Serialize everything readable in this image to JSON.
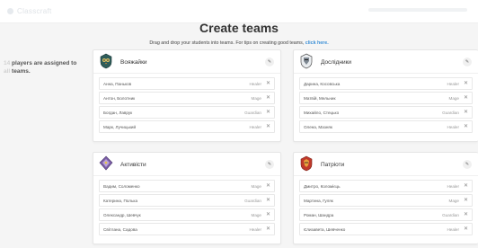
{
  "topbar": {
    "brand": "Classcraft"
  },
  "header": {
    "title": "Create teams",
    "subtitle_text": "Drag and drop your students into teams. For tips on creating good teams, ",
    "subtitle_link": "click here."
  },
  "side_note": {
    "number": "14",
    "text_1": " players are assigned to",
    "text_2": "teams."
  },
  "colors": {
    "link": "#3b8fd6",
    "accent_purple": "#7b5ea7",
    "accent_red": "#c0392b"
  },
  "teams": [
    {
      "name": "Вояжайки",
      "emblem": "owl-crest-icon",
      "players": [
        {
          "name": "Анна, Паньков",
          "role": "Healer"
        },
        {
          "name": "Антон, Болотник",
          "role": "Mage"
        },
        {
          "name": "Богдан, Лаврук",
          "role": "Guardian"
        },
        {
          "name": "Марк, Лучицький",
          "role": "Healer"
        }
      ]
    },
    {
      "name": "Дослідники",
      "emblem": "knight-crest-icon",
      "players": [
        {
          "name": "Дарина, Косовська",
          "role": "Healer"
        },
        {
          "name": "Матвій, Мельник",
          "role": "Mage"
        },
        {
          "name": "Михайло, Стецько",
          "role": "Guardian"
        },
        {
          "name": "Олена, Мазняк",
          "role": "Healer"
        }
      ]
    },
    {
      "name": "Активісти",
      "emblem": "dragon-crest-icon",
      "players": [
        {
          "name": "Вадим, Соломенко",
          "role": "Mage"
        },
        {
          "name": "Катерина, Полька",
          "role": "Guardian"
        },
        {
          "name": "Олександр, Шевчук",
          "role": "Mage"
        },
        {
          "name": "Світлана, Садова",
          "role": "Healer"
        }
      ]
    },
    {
      "name": "Патріоти",
      "emblem": "wolf-crest-icon",
      "players": [
        {
          "name": "Дмитро, Коломієць",
          "role": "Healer"
        },
        {
          "name": "Мартина, Гуляк",
          "role": "Mage"
        },
        {
          "name": "Роман, Шандра",
          "role": "Guardian"
        },
        {
          "name": "Єлизавета, Шевченко",
          "role": "Healer"
        }
      ]
    }
  ]
}
